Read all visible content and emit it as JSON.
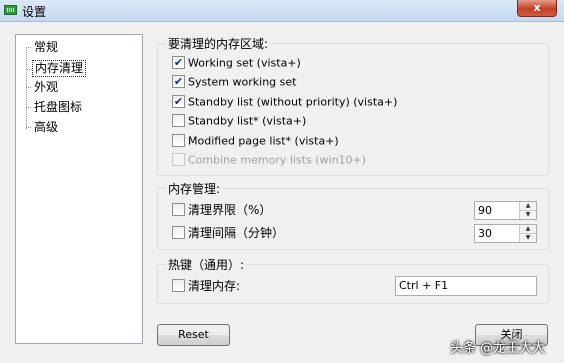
{
  "window": {
    "title": "设置",
    "close_glyph": "x"
  },
  "nav": {
    "items": [
      {
        "label": "常规"
      },
      {
        "label": "内存清理"
      },
      {
        "label": "外观"
      },
      {
        "label": "托盘图标"
      },
      {
        "label": "高级"
      }
    ],
    "selected_index": 1
  },
  "memory_area": {
    "title": "要清理的内存区域:",
    "options": [
      {
        "label": "Working set (vista+)",
        "checked": true,
        "disabled": false
      },
      {
        "label": "System working set",
        "checked": true,
        "disabled": false
      },
      {
        "label": "Standby list (without priority) (vista+)",
        "checked": true,
        "disabled": false
      },
      {
        "label": "Standby list* (vista+)",
        "checked": false,
        "disabled": false
      },
      {
        "label": "Modified page list* (vista+)",
        "checked": false,
        "disabled": false
      },
      {
        "label": "Combine memory lists (win10+)",
        "checked": false,
        "disabled": true
      }
    ]
  },
  "memory_mgmt": {
    "title": "内存管理:",
    "limit": {
      "label": "清理界限（%）",
      "checked": false,
      "value": "90"
    },
    "interval": {
      "label": "清理间隔（分钟）",
      "checked": false,
      "value": "30"
    }
  },
  "hotkey": {
    "title": "热键（通用）:",
    "clean": {
      "label": "清理内存:",
      "checked": false,
      "value": "Ctrl + F1"
    }
  },
  "buttons": {
    "reset": "Reset",
    "close": "关闭"
  },
  "watermark": "头条 @龙王大大",
  "spin_arrows": {
    "up": "▲",
    "down": "▼"
  }
}
